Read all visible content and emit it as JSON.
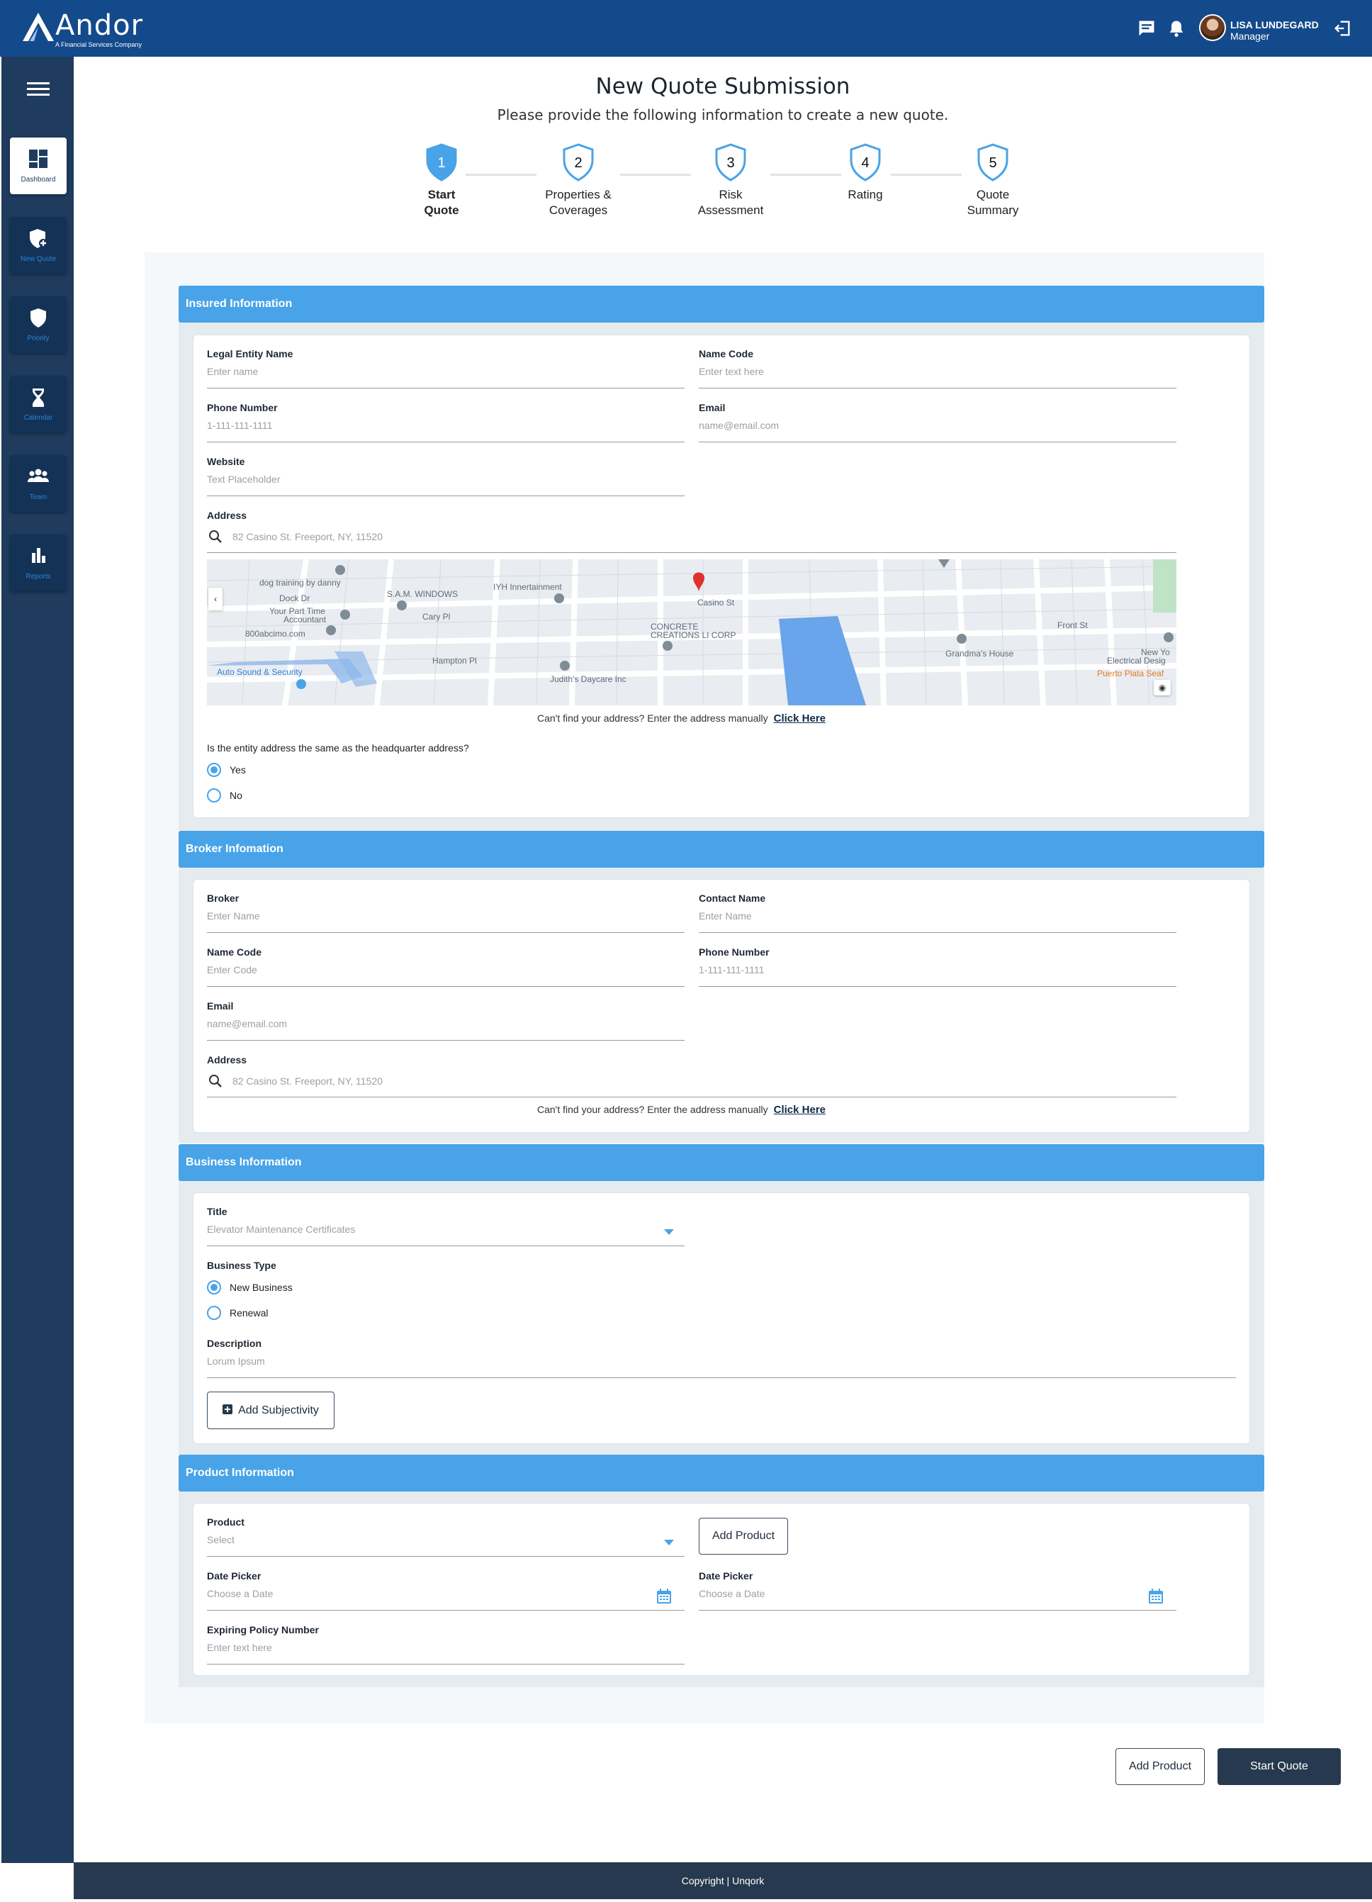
{
  "header": {
    "brand": "Andor",
    "tagline": "A Financial Services Company",
    "user_name": "LISA LUNDEGARD",
    "user_role": "Manager",
    "icons": [
      "chat-icon",
      "bell-icon",
      "logout-icon"
    ]
  },
  "sidebar": {
    "items": [
      {
        "label": "Dashboard",
        "icon": "dashboard-icon",
        "active": true
      },
      {
        "label": "New Quote",
        "icon": "shield-plus-icon"
      },
      {
        "label": "Priority",
        "icon": "shield-icon"
      },
      {
        "label": "Calendar",
        "icon": "hourglass-icon"
      },
      {
        "label": "Team",
        "icon": "team-icon"
      },
      {
        "label": "Reports",
        "icon": "bar-chart-icon"
      }
    ]
  },
  "page": {
    "title": "New Quote Submission",
    "subtitle": "Please provide the following information to create a new quote."
  },
  "steps": [
    {
      "num": "1",
      "label1": "Start",
      "label2": "Quote",
      "current": true
    },
    {
      "num": "2",
      "label1": "Properties &",
      "label2": "Coverages"
    },
    {
      "num": "3",
      "label1": "Risk",
      "label2": "Assessment"
    },
    {
      "num": "4",
      "label1": "Rating",
      "label2": ""
    },
    {
      "num": "5",
      "label1": "Quote",
      "label2": "Summary"
    }
  ],
  "insured": {
    "heading": "Insured Information",
    "legal_name": {
      "label": "Legal Entity Name",
      "placeholder": "Enter name"
    },
    "name_code": {
      "label": "Name Code",
      "placeholder": "Enter text here"
    },
    "phone": {
      "label": "Phone Number",
      "placeholder": "1-111-111-1111"
    },
    "email": {
      "label": "Email",
      "placeholder": "name@email.com"
    },
    "website": {
      "label": "Website",
      "placeholder": "Text Placeholder"
    },
    "address": {
      "label": "Address",
      "placeholder": "82 Casino St. Freeport, NY, 11520"
    },
    "hint": "Can't find your address? Enter the address manually",
    "hint_link": "Click Here",
    "question": "Is the entity address the same as the headquarter address?",
    "yes": "Yes",
    "no": "No",
    "map_labels": [
      "dog training by danny",
      "S.A.M. WINDOWS",
      "IYH Innertainment",
      "Your Part Time",
      "Accountant",
      "800abcimo.com",
      "Auto Sound & Security",
      "Judith's Daycare Inc",
      "CONCRETE",
      "CREATIONS LI CORP",
      "Grandma's House",
      "New Yo",
      "Electrical Desig",
      "Puerto Plata Seaf",
      "Casino St",
      "Cary Pl",
      "Hampton Pl",
      "Front St",
      "Dock Dr"
    ]
  },
  "broker": {
    "heading": "Broker Infomation",
    "broker": {
      "label": "Broker",
      "placeholder": "Enter Name"
    },
    "contact": {
      "label": "Contact Name",
      "placeholder": "Enter Name"
    },
    "name_code": {
      "label": "Name Code",
      "placeholder": "Enter Code"
    },
    "phone": {
      "label": "Phone Number",
      "placeholder": "1-111-111-1111"
    },
    "email": {
      "label": "Email",
      "placeholder": "name@email.com"
    },
    "address": {
      "label": "Address",
      "placeholder": "82 Casino St. Freeport, NY, 11520"
    },
    "hint": "Can't find your address? Enter the address manually",
    "hint_link": "Click Here"
  },
  "business": {
    "heading": "Business Information",
    "title": {
      "label": "Title",
      "value": "Elevator Maintenance Certificates"
    },
    "type_label": "Business Type",
    "new_business": "New Business",
    "renewal": "Renewal",
    "description": {
      "label": "Description",
      "placeholder": "Lorum Ipsum"
    },
    "add_subjectivity": "Add Subjectivity"
  },
  "product": {
    "heading": "Product Information",
    "product": {
      "label": "Product",
      "placeholder": "Select"
    },
    "add_product": "Add Product",
    "date1": {
      "label": "Date Picker",
      "placeholder": "Choose a Date"
    },
    "date2": {
      "label": "Date Picker",
      "placeholder": "Choose a Date"
    },
    "expiring": {
      "label": "Expiring Policy Number",
      "placeholder": "Enter text here"
    }
  },
  "actions": {
    "add_product": "Add Product",
    "start_quote": "Start Quote"
  },
  "footer": {
    "left": "Copyright",
    "right": "Unqork"
  },
  "colors": {
    "brand": "#134a8b",
    "sidebar": "#1f3b5e",
    "accent": "#48a3e8",
    "dark_button": "#27394e"
  }
}
